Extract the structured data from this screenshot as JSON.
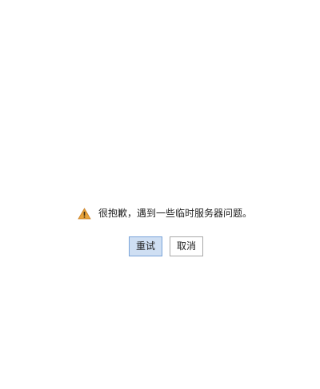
{
  "dialog": {
    "message": "很抱歉，遇到一些临时服务器问题。",
    "icon": "warning-icon",
    "icon_color": "#e8a33a"
  },
  "buttons": {
    "retry_label": "重试",
    "cancel_label": "取消"
  },
  "colors": {
    "retry_background": "#cfdff3",
    "retry_border": "#7aa3d9",
    "cancel_border": "#a9a9a9"
  }
}
